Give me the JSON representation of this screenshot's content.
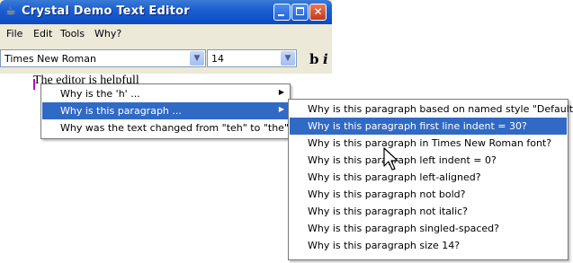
{
  "window": {
    "title": "Crystal Demo Text Editor",
    "minimize_icon": "minimize-icon",
    "maximize_icon": "maximize-icon",
    "close_icon": "close-icon"
  },
  "menubar": {
    "items": [
      "File",
      "Edit",
      "Tools",
      "Why?"
    ]
  },
  "toolbar": {
    "font_value": "Times New Roman",
    "size_value": "14",
    "bold_label": "b",
    "italic_label": "i"
  },
  "editor": {
    "text": "The editor is helpfull"
  },
  "context_menu": {
    "items": [
      {
        "label": "Why is the 'h' ...",
        "submenu": true
      },
      {
        "label": "Why is this paragraph ...",
        "submenu": true,
        "selected": true
      },
      {
        "label": "Why was the text changed from \"teh\" to \"the\"?",
        "submenu": false
      }
    ]
  },
  "submenu": {
    "items": [
      "Why is this paragraph based on named style \"Default\" ?",
      "Why is this paragraph first line indent = 30?",
      "Why is this paragraph in Times New Roman font?",
      "Why is this paragraph left indent = 0?",
      "Why is this paragraph left-aligned?",
      "Why is this paragraph not bold?",
      "Why is this paragraph not italic?",
      "Why is this paragraph singled-spaced?",
      "Why is this paragraph size 14?"
    ],
    "selected_index": 1
  },
  "colors": {
    "titlebar": "#0a4bc4",
    "selection": "#316ac5",
    "caret": "#c000c0"
  }
}
